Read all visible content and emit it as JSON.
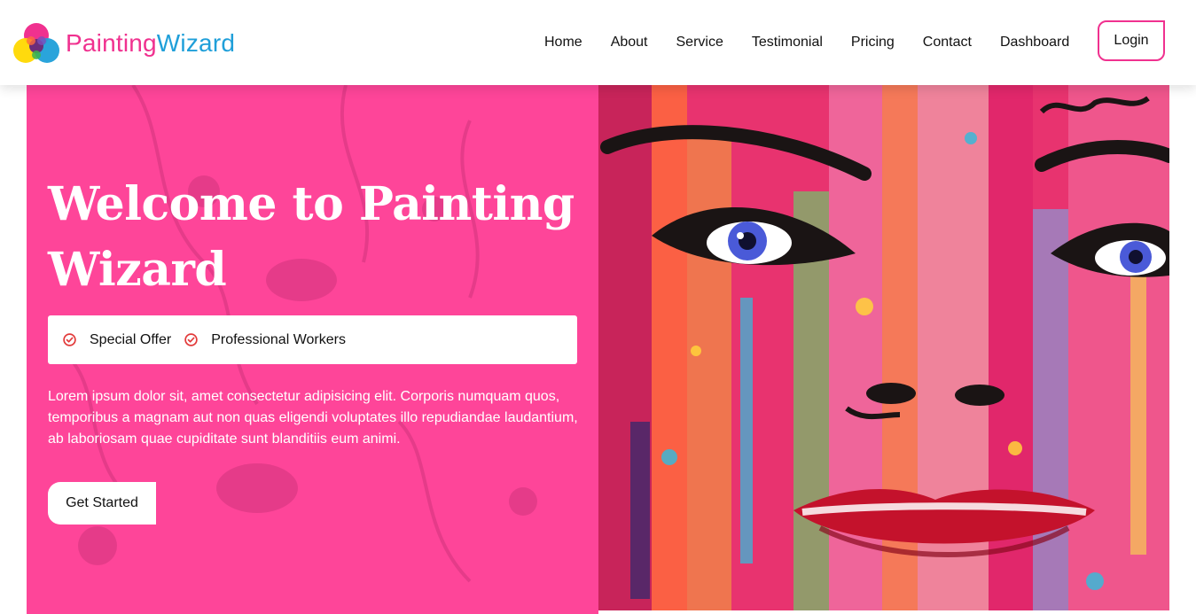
{
  "brand": {
    "part1": "Painting",
    "part2": "Wizard",
    "icon": "color-wheel-logo-icon"
  },
  "nav": {
    "links": [
      "Home",
      "About",
      "Service",
      "Testimonial",
      "Pricing",
      "Contact",
      "Dashboard"
    ],
    "login_label": "Login"
  },
  "hero": {
    "title": "Welcome to Painting Wizard",
    "features": [
      {
        "icon": "check-circle-icon",
        "label": "Special Offer"
      },
      {
        "icon": "check-circle-icon",
        "label": "Professional Workers"
      }
    ],
    "description": "Lorem ipsum dolor sit, amet consectetur adipisicing elit. Corporis numquam quos, temporibus a magnam aut non quas eligendi voluptates illo repudiandae laudantium, ab laboriosam quae cupiditate sunt blanditiis eum animi.",
    "cta_label": "Get Started",
    "image": "colorful-face-graffiti-painting"
  },
  "colors": {
    "accent": "#f0318f",
    "hero_bg": "#fe4599",
    "brand_blue": "#1f9fd9"
  }
}
